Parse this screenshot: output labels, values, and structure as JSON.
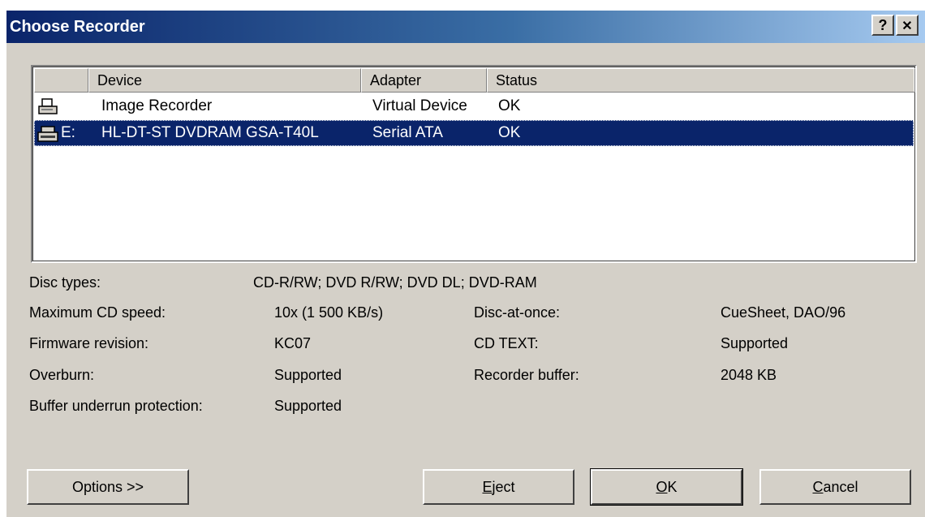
{
  "window": {
    "title": "Choose Recorder",
    "help_label": "?",
    "close_label": "✕"
  },
  "list": {
    "columns": [
      "Device",
      "Adapter",
      "Status"
    ],
    "rows": [
      {
        "icon": "printer-icon",
        "drive": "",
        "device": "Image Recorder",
        "adapter": "Virtual Device",
        "status": "OK",
        "selected": false
      },
      {
        "icon": "drive-icon",
        "drive": "E:",
        "device": "HL-DT-ST DVDRAM GSA-T40L",
        "adapter": "Serial ATA",
        "status": "OK",
        "selected": true
      }
    ]
  },
  "details": {
    "disc_types_label": "Disc types:",
    "disc_types_value": "CD-R/RW; DVD R/RW; DVD DL; DVD-RAM",
    "max_cd_speed_label": "Maximum CD speed:",
    "max_cd_speed_value": "10x (1 500 KB/s)",
    "firmware_label": "Firmware revision:",
    "firmware_value": "KC07",
    "overburn_label": "Overburn:",
    "overburn_value": "Supported",
    "buffer_underrun_label": "Buffer underrun protection:",
    "buffer_underrun_value": "Supported",
    "dao_label": "Disc-at-once:",
    "dao_value": "CueSheet, DAO/96",
    "cdtext_label": "CD TEXT:",
    "cdtext_value": "Supported",
    "buffer_label": "Recorder buffer:",
    "buffer_value": "2048 KB"
  },
  "buttons": {
    "options": "Options >>",
    "eject_mnemonic": "E",
    "eject_rest": "ject",
    "ok_mnemonic": "O",
    "ok_rest": "K",
    "cancel_mnemonic": "C",
    "cancel_rest": "ancel"
  }
}
